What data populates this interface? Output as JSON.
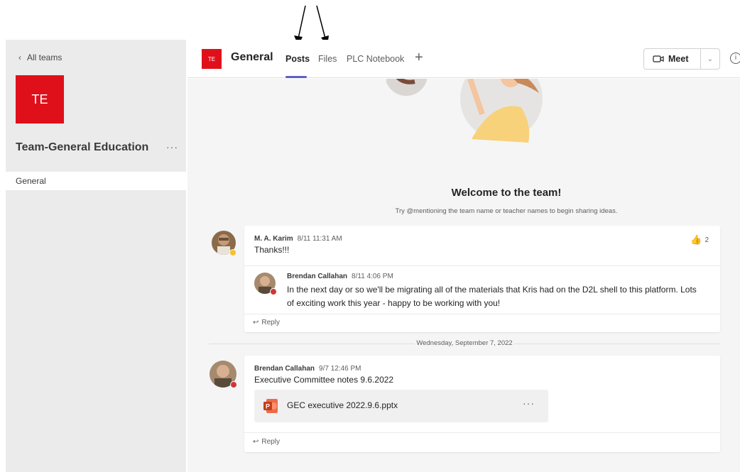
{
  "sidebar": {
    "back_label": "All teams",
    "team_initials": "TE",
    "team_name": "Team-General Education",
    "more_label": "···",
    "channels": [
      "General"
    ]
  },
  "header": {
    "channel_initials": "TE",
    "channel_title": "General",
    "tabs": [
      {
        "label": "Posts",
        "active": true
      },
      {
        "label": "Files",
        "active": false
      },
      {
        "label": "PLC Notebook",
        "active": false
      }
    ],
    "add_tab": "+",
    "meet_label": "Meet",
    "info_label": "i"
  },
  "welcome": {
    "title": "Welcome to the team!",
    "subtitle": "Try @mentioning the team name or teacher names to begin sharing ideas."
  },
  "threads": [
    {
      "author": "M. A. Karim",
      "time": "8/11 11:31 AM",
      "text": "Thanks!!!",
      "reaction_count": "2",
      "reply": {
        "author": "Brendan Callahan",
        "time": "8/11 4:06 PM",
        "text": "In the next day or so we'll be migrating all of the materials that Kris had on the D2L shell to this platform. Lots of exciting work this year - happy to be working with you!"
      },
      "reply_label": "Reply"
    },
    {
      "author": "Brendan Callahan",
      "time": "9/7 12:46 PM",
      "text": "Executive Committee notes 9.6.2022",
      "attachment": "GEC executive 2022.9.6.pptx",
      "attachment_more": "···",
      "reply_label": "Reply"
    }
  ],
  "date_separator": "Wednesday, September 7, 2022",
  "colors": {
    "accent": "#5b5fc7",
    "team_red": "#e0101b",
    "sidebar_bg": "#ebebeb",
    "feed_bg": "#f5f5f5"
  }
}
